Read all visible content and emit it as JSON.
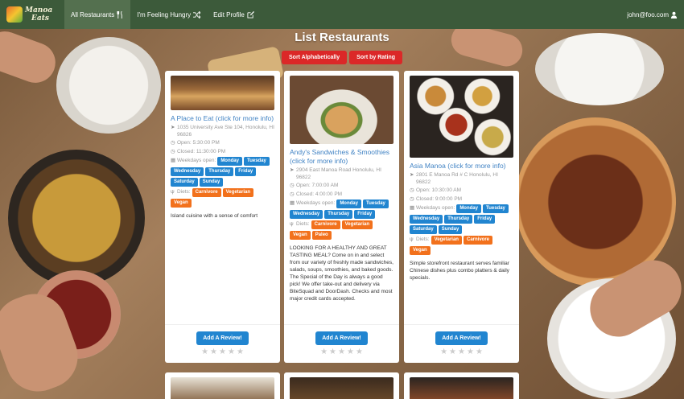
{
  "navbar": {
    "logo_line1": "Manoa",
    "logo_line2": "Eats",
    "items": [
      {
        "label": "All Restaurants",
        "icon": "utensils-icon",
        "active": true
      },
      {
        "label": "I'm Feeling Hungry",
        "icon": "shuffle-icon",
        "active": false
      },
      {
        "label": "Edit Profile",
        "icon": "edit-icon",
        "active": false
      }
    ],
    "user_email": "john@foo.com",
    "user_icon": "user-icon"
  },
  "page": {
    "title": "List Restaurants",
    "sort_alpha": "Sort Alphabetically",
    "sort_rating": "Sort by Rating"
  },
  "colors": {
    "navbar": "#3c5a3a",
    "navbar_active": "#54704f",
    "sort_button": "#db2828",
    "primary_button": "#2185d0",
    "link": "#4183c4",
    "day_tag": "#2185d0",
    "diet_tag": "#f2711c"
  },
  "cards": [
    {
      "name": "A Place to Eat (click for more info)",
      "address": "1035 University Ave Ste 104, Honolulu, HI 96826",
      "open": "Open: 5:30:00 PM",
      "closed": "Closed: 11:30:00 PM",
      "weekdays_label": "Weekdays open:",
      "days": [
        "Monday",
        "Tuesday",
        "Wednesday",
        "Thursday",
        "Friday",
        "Saturday",
        "Sunday"
      ],
      "diets_label": "Diets:",
      "diets": [
        "Carnivore",
        "Vegetarian",
        "Vegan"
      ],
      "description": "Island cuisine with a sense of comfort",
      "review_label": "Add A Review!",
      "rating": 0
    },
    {
      "name": "Andy's Sandwiches & Smoothies (click for more info)",
      "address": "2904 East Manoa Road Honolulu, HI 96822",
      "open": "Open: 7:00:00 AM",
      "closed": "Closed: 4:00:00 PM",
      "weekdays_label": "Weekdays open:",
      "days": [
        "Monday",
        "Tuesday",
        "Wednesday",
        "Thursday",
        "Friday"
      ],
      "diets_label": "Diets:",
      "diets": [
        "Carnivore",
        "Vegetarian",
        "Vegan",
        "Paleo"
      ],
      "description": "LOOKING FOR A HEALTHY AND GREAT TASTING MEAL? Come on in and select from our variety of freshly made sandwiches, salads, soups, smoothies, and baked goods. The Special of the Day is always a good pick! We offer take-out and delivery via BiteSquad and DoorDash. Checks and most major credit cards accepted.",
      "review_label": "Add A Review!",
      "rating": 0
    },
    {
      "name": "Asia Manoa (click for more info)",
      "address": "2801 E Manoa Rd # C Honolulu, HI 96822",
      "open": "Open: 10:30:00 AM",
      "closed": "Closed: 9:00:00 PM",
      "weekdays_label": "Weekdays open:",
      "days": [
        "Monday",
        "Tuesday",
        "Wednesday",
        "Thursday",
        "Friday",
        "Saturday",
        "Sunday"
      ],
      "diets_label": "Diets:",
      "diets": [
        "Vegetarian",
        "Carnivore",
        "Vegan"
      ],
      "description": "Simple storefront restaurant serves familiar Chinese dishes plus combo platters & daily specials.",
      "review_label": "Add A Review!",
      "rating": 0
    }
  ]
}
